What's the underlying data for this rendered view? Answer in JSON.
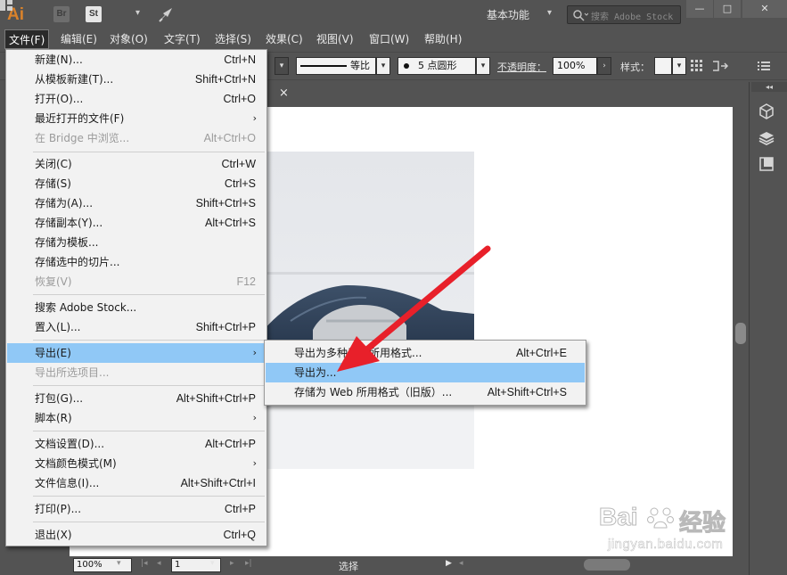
{
  "app": {
    "logo": "Ai",
    "bridge_icon": "Br",
    "stock_icon": "St",
    "workspace": "基本功能",
    "search_placeholder": "搜索 Adobe Stock",
    "window_buttons": {
      "minimize": "—",
      "maximize": "□",
      "close": "✕"
    }
  },
  "menubar": [
    "文件(F)",
    "编辑(E)",
    "对象(O)",
    "文字(T)",
    "选择(S)",
    "效果(C)",
    "视图(V)",
    "窗口(W)",
    "帮助(H)"
  ],
  "controlbar": {
    "stroke_profile": "等比",
    "brush": "5 点圆形",
    "opacity_label": "不透明度：",
    "opacity_value": "100%",
    "style_label": "样式："
  },
  "tab": {
    "close": "×"
  },
  "file_menu": [
    {
      "label": "新建(N)...",
      "shortcut": "Ctrl+N"
    },
    {
      "label": "从模板新建(T)...",
      "shortcut": "Shift+Ctrl+N"
    },
    {
      "label": "打开(O)...",
      "shortcut": "Ctrl+O"
    },
    {
      "label": "最近打开的文件(F)",
      "submenu": true
    },
    {
      "label": "在 Bridge 中浏览...",
      "shortcut": "Alt+Ctrl+O",
      "disabled": true
    },
    {
      "label": "关闭(C)",
      "shortcut": "Ctrl+W"
    },
    {
      "label": "存储(S)",
      "shortcut": "Ctrl+S"
    },
    {
      "label": "存储为(A)...",
      "shortcut": "Shift+Ctrl+S"
    },
    {
      "label": "存储副本(Y)...",
      "shortcut": "Alt+Ctrl+S"
    },
    {
      "label": "存储为模板..."
    },
    {
      "label": "存储选中的切片..."
    },
    {
      "label": "恢复(V)",
      "shortcut": "F12",
      "disabled": true
    },
    {
      "label": "搜索 Adobe Stock..."
    },
    {
      "label": "置入(L)...",
      "shortcut": "Shift+Ctrl+P"
    },
    {
      "label": "导出(E)",
      "submenu": true,
      "highlighted": true
    },
    {
      "label": "导出所选项目...",
      "disabled": true
    },
    {
      "label": "打包(G)...",
      "shortcut": "Alt+Shift+Ctrl+P"
    },
    {
      "label": "脚本(R)",
      "submenu": true
    },
    {
      "label": "文档设置(D)...",
      "shortcut": "Alt+Ctrl+P"
    },
    {
      "label": "文档颜色模式(M)",
      "submenu": true
    },
    {
      "label": "文件信息(I)...",
      "shortcut": "Alt+Shift+Ctrl+I"
    },
    {
      "label": "打印(P)...",
      "shortcut": "Ctrl+P"
    },
    {
      "label": "退出(X)",
      "shortcut": "Ctrl+Q"
    }
  ],
  "export_submenu": [
    {
      "label": "导出为多种屏幕所用格式...",
      "shortcut": "Alt+Ctrl+E"
    },
    {
      "label": "导出为...",
      "highlighted": true
    },
    {
      "label": "存储为 Web 所用格式（旧版）...",
      "shortcut": "Alt+Shift+Ctrl+S"
    }
  ],
  "statusbar": {
    "zoom": "100%",
    "page": "1",
    "tool": "选择"
  },
  "watermark": {
    "brand": "Bai",
    "brand2": "经验",
    "url": "jingyan.baidu.com"
  },
  "colors": {
    "menu_highlight": "#90c8f6",
    "annotation_arrow": "#e8202a",
    "ai_orange": "#d9822b"
  }
}
